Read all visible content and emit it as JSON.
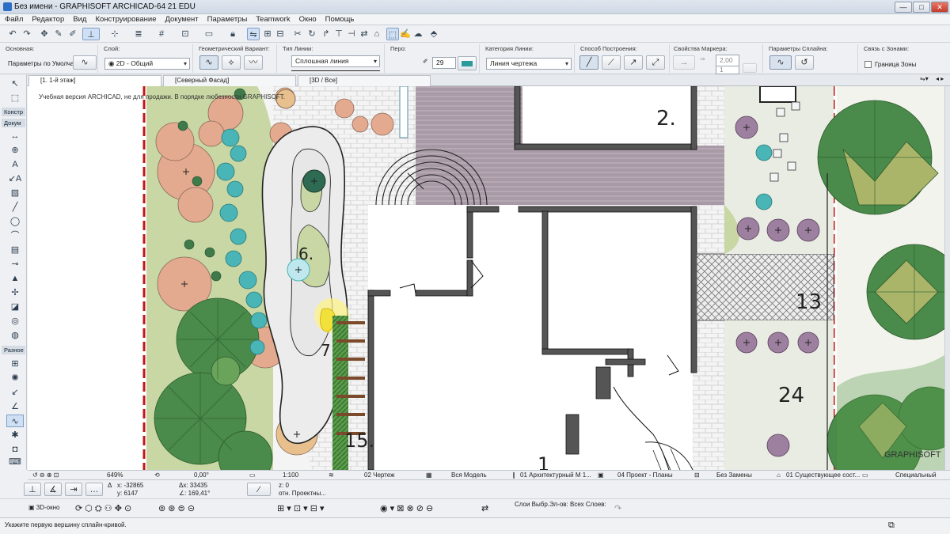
{
  "window": {
    "title": "Без имени - GRAPHISOFT ARCHICAD-64 21 EDU",
    "min": "—",
    "max": "□",
    "close": "✕"
  },
  "menu": [
    "Файл",
    "Редактор",
    "Вид",
    "Конструирование",
    "Документ",
    "Параметры",
    "Teamwork",
    "Окно",
    "Помощь"
  ],
  "infobox": {
    "main_label": "Основная:",
    "main_value": "Параметры по Умолчанию",
    "layer_label": "Слой:",
    "layer_value": "2D - Общий",
    "geom_label": "Геометрический Вариант:",
    "linetype_label": "Тип Линии:",
    "linetype_value": "Сплошная линия",
    "pen_label": "Перо:",
    "pen_value": "29",
    "linecat_label": "Категория Линии:",
    "linecat_value": "Линия чертежа",
    "method_label": "Способ Построения:",
    "marker_label": "Свойства Маркера:",
    "marker_v1": "2,00",
    "marker_v2": "1",
    "spline_label": "Параметры Сплайна:",
    "zone_label": "Связь с Зонами:",
    "zone_value": "Граница Зоны"
  },
  "tabs": [
    "[1. 1-й этаж]",
    "[Северный Фасад]",
    "[3D / Все]"
  ],
  "toolbox": {
    "section1": "Констр",
    "section2": "Докум",
    "section3": "Разное"
  },
  "canvas": {
    "watermark": "Учебная версия ARCHICAD, не для продажи. В порядке любезности GRAPHISOFT.",
    "labels": [
      "2.",
      "6.",
      "7",
      "13",
      "24",
      "15.",
      "1"
    ],
    "brand": "GRAPHISOFT",
    "colors": {
      "hedge": "#c8d7a4",
      "shrub_pink": "#e4aa8f",
      "tree_green": "#4a8a4a",
      "teal": "#4ab5b6",
      "purple": "#9d7fa0",
      "red_line": "#c0161b",
      "deck": "#a89aa6",
      "wall": "#555555"
    }
  },
  "status": {
    "zoom": "649%",
    "angle": "0,00°",
    "scale": "1:100",
    "layer_combo": "02 Чертеж",
    "model": "Вся Модель",
    "pen_set": "01 Архитектурный М 1...",
    "mvo": "04 Проект - Планы",
    "override": "Без Замены",
    "reno": "01 Существующее сост...",
    "structure": "Специальный"
  },
  "coords": {
    "x": "x: -32865",
    "y": "y: 6147",
    "dx": "Δx: 33435",
    "dangle": "∠: 169,41°",
    "z": "z: 0",
    "ref": "отн. Проектны..."
  },
  "bottom": {
    "view3d": "3D-окно",
    "sel_layers": "Слои Выбр.Эл-ов:",
    "all_layers": "Всех Слоев:"
  },
  "hint": "Укажите первую вершину сплайн-кривой."
}
